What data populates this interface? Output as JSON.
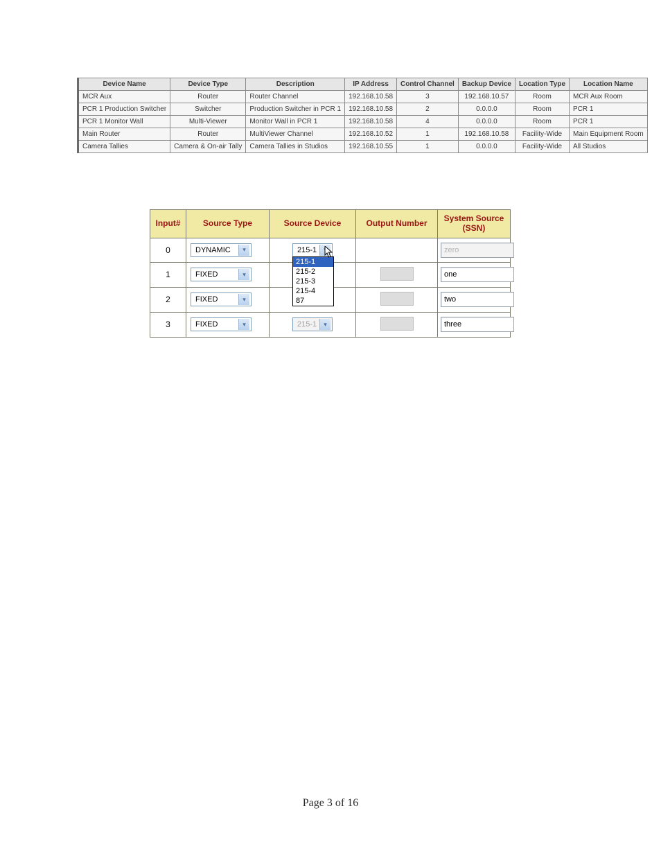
{
  "devices_table": {
    "headers": [
      "Device Name",
      "Device Type",
      "Description",
      "IP Address",
      "Control Channel",
      "Backup Device",
      "Location Type",
      "Location Name"
    ],
    "rows": [
      {
        "name": "MCR Aux",
        "type": "Router",
        "desc": "Router Channel",
        "ip": "192.168.10.58",
        "ctrl": "3",
        "bkup": "192.168.10.57",
        "loctype": "Room",
        "locname": "MCR Aux Room"
      },
      {
        "name": "PCR 1 Production Switcher",
        "type": "Switcher",
        "desc": "Production Switcher in PCR 1",
        "ip": "192.168.10.58",
        "ctrl": "2",
        "bkup": "0.0.0.0",
        "loctype": "Room",
        "locname": "PCR 1"
      },
      {
        "name": "PCR 1 Monitor Wall",
        "type": "Multi-Viewer",
        "desc": "Monitor Wall in PCR 1",
        "ip": "192.168.10.58",
        "ctrl": "4",
        "bkup": "0.0.0.0",
        "loctype": "Room",
        "locname": "PCR 1"
      },
      {
        "name": "Main Router",
        "type": "Router",
        "desc": "MultiViewer Channel",
        "ip": "192.168.10.52",
        "ctrl": "1",
        "bkup": "192.168.10.58",
        "loctype": "Facility-Wide",
        "locname": "Main Equipment Room"
      },
      {
        "name": "Camera Tallies",
        "type": "Camera & On-air Tally",
        "desc": "Camera Tallies in Studios",
        "ip": "192.168.10.55",
        "ctrl": "1",
        "bkup": "0.0.0.0",
        "loctype": "Facility-Wide",
        "locname": "All Studios"
      }
    ]
  },
  "inputs_table": {
    "headers": {
      "input": "Input#",
      "stype": "Source Type",
      "sdev": "Source Device",
      "onum": "Output Number",
      "ssn": "System Source (SSN)"
    },
    "rows": [
      {
        "input": "0",
        "stype": "DYNAMIC",
        "sdev": "215-1",
        "sdev_disabled": false,
        "ssn": "zero",
        "ssn_disabled": true,
        "has_output_box": false
      },
      {
        "input": "1",
        "stype": "FIXED",
        "sdev": "",
        "sdev_disabled": false,
        "ssn": "one",
        "ssn_disabled": false,
        "has_output_box": true
      },
      {
        "input": "2",
        "stype": "FIXED",
        "sdev": "",
        "sdev_disabled": false,
        "ssn": "two",
        "ssn_disabled": false,
        "has_output_box": true
      },
      {
        "input": "3",
        "stype": "FIXED",
        "sdev": "215-1",
        "sdev_disabled": true,
        "ssn": "three",
        "ssn_disabled": false,
        "has_output_box": true
      }
    ],
    "dropdown_options": [
      "215-1",
      "215-2",
      "215-3",
      "215-4",
      "87"
    ],
    "dropdown_highlight": "215-1"
  },
  "page_footer": "Page 3 of 16"
}
